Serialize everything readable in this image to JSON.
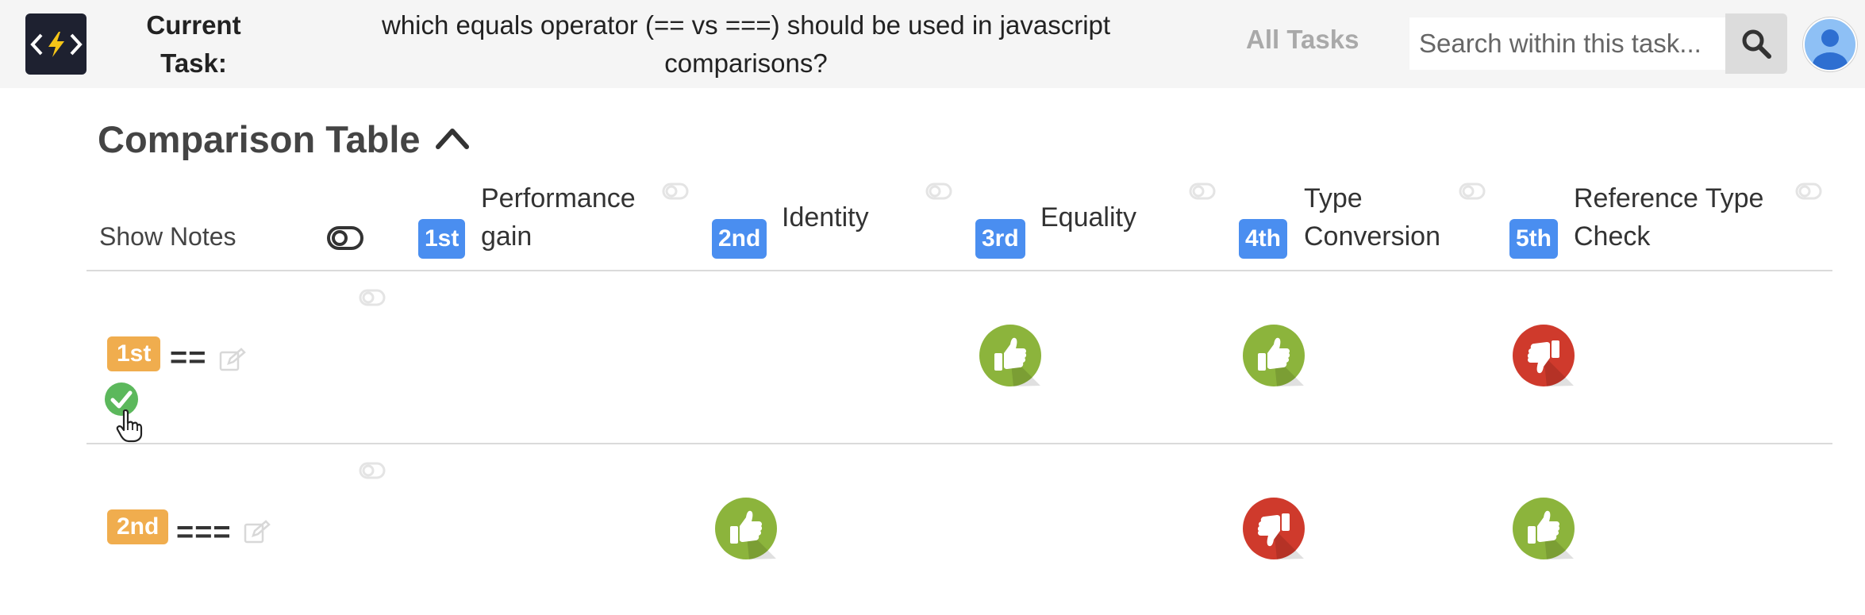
{
  "header": {
    "logo": {
      "icon": "bolt-code-icon",
      "text_left": "<",
      "text_right": ">"
    },
    "current_task_label": "Current Task:",
    "task_title": "which equals operator (== vs ===) should be used in javascript comparisons?",
    "all_tasks_label": "All Tasks",
    "search": {
      "placeholder": "Search within this task...",
      "value": ""
    },
    "search_icon": "magnifier-icon",
    "avatar_icon": "user-avatar-icon"
  },
  "section": {
    "title": "Comparison Table",
    "collapse_icon": "chevron-up-icon"
  },
  "table": {
    "show_notes_label": "Show Notes",
    "columns": [
      {
        "rank": "1st",
        "label_line1": "Performance",
        "label_line2": "gain"
      },
      {
        "rank": "2nd",
        "label_line1": "Identity",
        "label_line2": ""
      },
      {
        "rank": "3rd",
        "label_line1": "Equality",
        "label_line2": ""
      },
      {
        "rank": "4th",
        "label_line1": "Type",
        "label_line2": "Conversion"
      },
      {
        "rank": "5th",
        "label_line1": "Reference Type",
        "label_line2": "Check"
      }
    ],
    "rows": [
      {
        "rank": "1st",
        "name": "==",
        "selected": true,
        "votes": [
          "none",
          "none",
          "up",
          "up",
          "down"
        ]
      },
      {
        "rank": "2nd",
        "name": "===",
        "selected": false,
        "votes": [
          "none",
          "up",
          "none",
          "down",
          "up"
        ]
      }
    ]
  },
  "colors": {
    "topbar_bg": "#f5f5f5",
    "logo_bg": "#1e2130",
    "rank_blue": "#4a8ef0",
    "rank_orange": "#f0ad4e",
    "thumb_up": "#8cb43c",
    "thumb_down": "#cf3a2c",
    "check_green": "#5cb85c"
  }
}
